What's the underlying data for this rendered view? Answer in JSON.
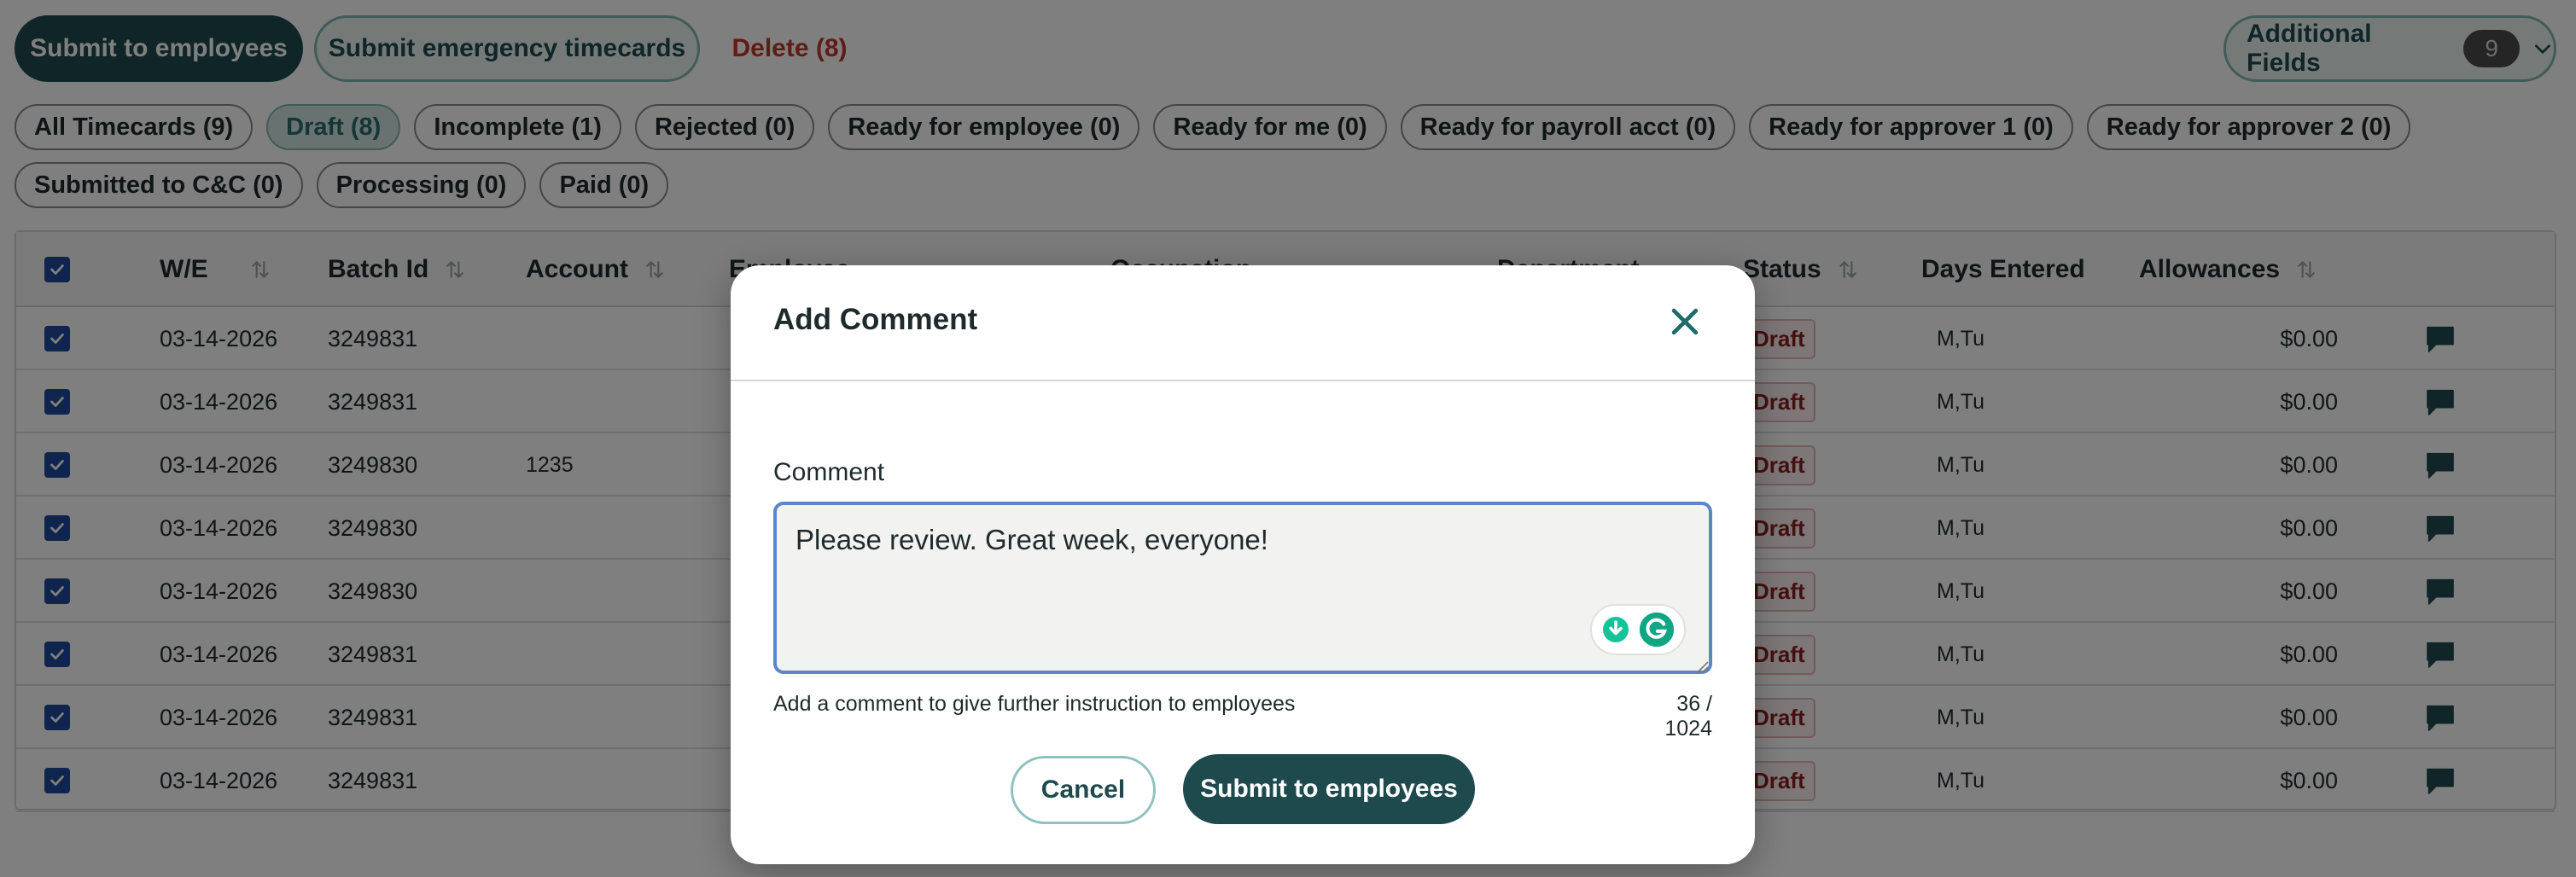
{
  "toolbar": {
    "submit_employees_label": "Submit to employees",
    "submit_emergency_label": "Submit emergency timecards",
    "delete_label": "Delete (8)",
    "additional_fields_label": "Additional Fields",
    "additional_fields_count": "9"
  },
  "filters": {
    "row1": [
      {
        "label": "All Timecards (9)",
        "active": false
      },
      {
        "label": "Draft (8)",
        "active": true
      },
      {
        "label": "Incomplete (1)",
        "active": false
      },
      {
        "label": "Rejected (0)",
        "active": false
      },
      {
        "label": "Ready for employee (0)",
        "active": false
      },
      {
        "label": "Ready for me (0)",
        "active": false
      },
      {
        "label": "Ready for payroll acct (0)",
        "active": false
      },
      {
        "label": "Ready for approver 1 (0)",
        "active": false
      },
      {
        "label": "Ready for approver 2 (0)",
        "active": false
      }
    ],
    "row2": [
      {
        "label": "Submitted to C&C (0)",
        "active": false
      },
      {
        "label": "Processing (0)",
        "active": false
      },
      {
        "label": "Paid (0)",
        "active": false
      }
    ]
  },
  "table": {
    "headers": {
      "we": "W/E",
      "batch_id": "Batch Id",
      "account": "Account",
      "employee": "Employee",
      "occupation": "Occupation",
      "department": "Department",
      "status": "Status",
      "days_entered": "Days Entered",
      "allowances": "Allowances"
    },
    "rows": [
      {
        "we": "03-14-2026",
        "batch_id": "3249831",
        "account": "",
        "status": "Draft",
        "days_entered": "M,Tu",
        "allowances": "$0.00"
      },
      {
        "we": "03-14-2026",
        "batch_id": "3249831",
        "account": "",
        "status": "Draft",
        "days_entered": "M,Tu",
        "allowances": "$0.00"
      },
      {
        "we": "03-14-2026",
        "batch_id": "3249830",
        "account": "1235",
        "status": "Draft",
        "days_entered": "M,Tu",
        "allowances": "$0.00"
      },
      {
        "we": "03-14-2026",
        "batch_id": "3249830",
        "account": "",
        "status": "Draft",
        "days_entered": "M,Tu",
        "allowances": "$0.00"
      },
      {
        "we": "03-14-2026",
        "batch_id": "3249830",
        "account": "",
        "status": "Draft",
        "days_entered": "M,Tu",
        "allowances": "$0.00"
      },
      {
        "we": "03-14-2026",
        "batch_id": "3249831",
        "account": "",
        "status": "Draft",
        "days_entered": "M,Tu",
        "allowances": "$0.00"
      },
      {
        "we": "03-14-2026",
        "batch_id": "3249831",
        "account": "",
        "status": "Draft",
        "days_entered": "M,Tu",
        "allowances": "$0.00"
      },
      {
        "we": "03-14-2026",
        "batch_id": "3249831",
        "account": "",
        "status": "Draft",
        "days_entered": "M,Tu",
        "allowances": "$0.00"
      }
    ]
  },
  "modal": {
    "title": "Add Comment",
    "field_label": "Comment",
    "comment_value": "Please review. Great week, everyone!",
    "helper_text": "Add a comment to give further instruction to employees",
    "counter": "36 / 1024",
    "cancel_label": "Cancel",
    "submit_label": "Submit to employees"
  },
  "colors": {
    "primary": "#1e4a4e",
    "accent_border": "#7fb7b5",
    "delete": "#c0392b",
    "checkbox": "#1e4a9a",
    "draft_badge_text": "#8a1f1f",
    "overlay": "rgba(0,0,0,0.5)"
  }
}
